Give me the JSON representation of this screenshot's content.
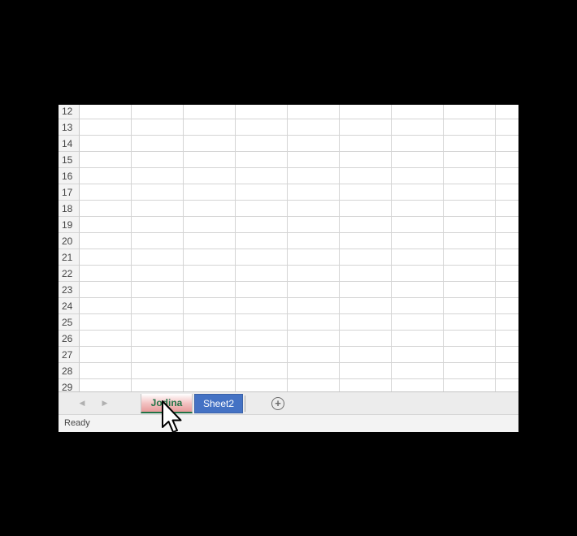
{
  "rows": [
    "12",
    "13",
    "14",
    "15",
    "16",
    "17",
    "18",
    "19",
    "20",
    "21",
    "22",
    "23",
    "24",
    "25",
    "26",
    "27",
    "28",
    "29"
  ],
  "sheet_tabs": [
    {
      "label": "Jodina",
      "active": true
    },
    {
      "label": "Sheet2",
      "active": false
    }
  ],
  "navigation": {
    "prev_icon": "triangle-left-icon",
    "next_icon": "triangle-right-icon",
    "add_icon": "plus-circle-icon"
  },
  "status_bar": {
    "text": "Ready"
  },
  "colors": {
    "active_tab_text": "#217346",
    "selected_tab_bg": "#4472c4",
    "gridline": "#d4d4d4"
  }
}
